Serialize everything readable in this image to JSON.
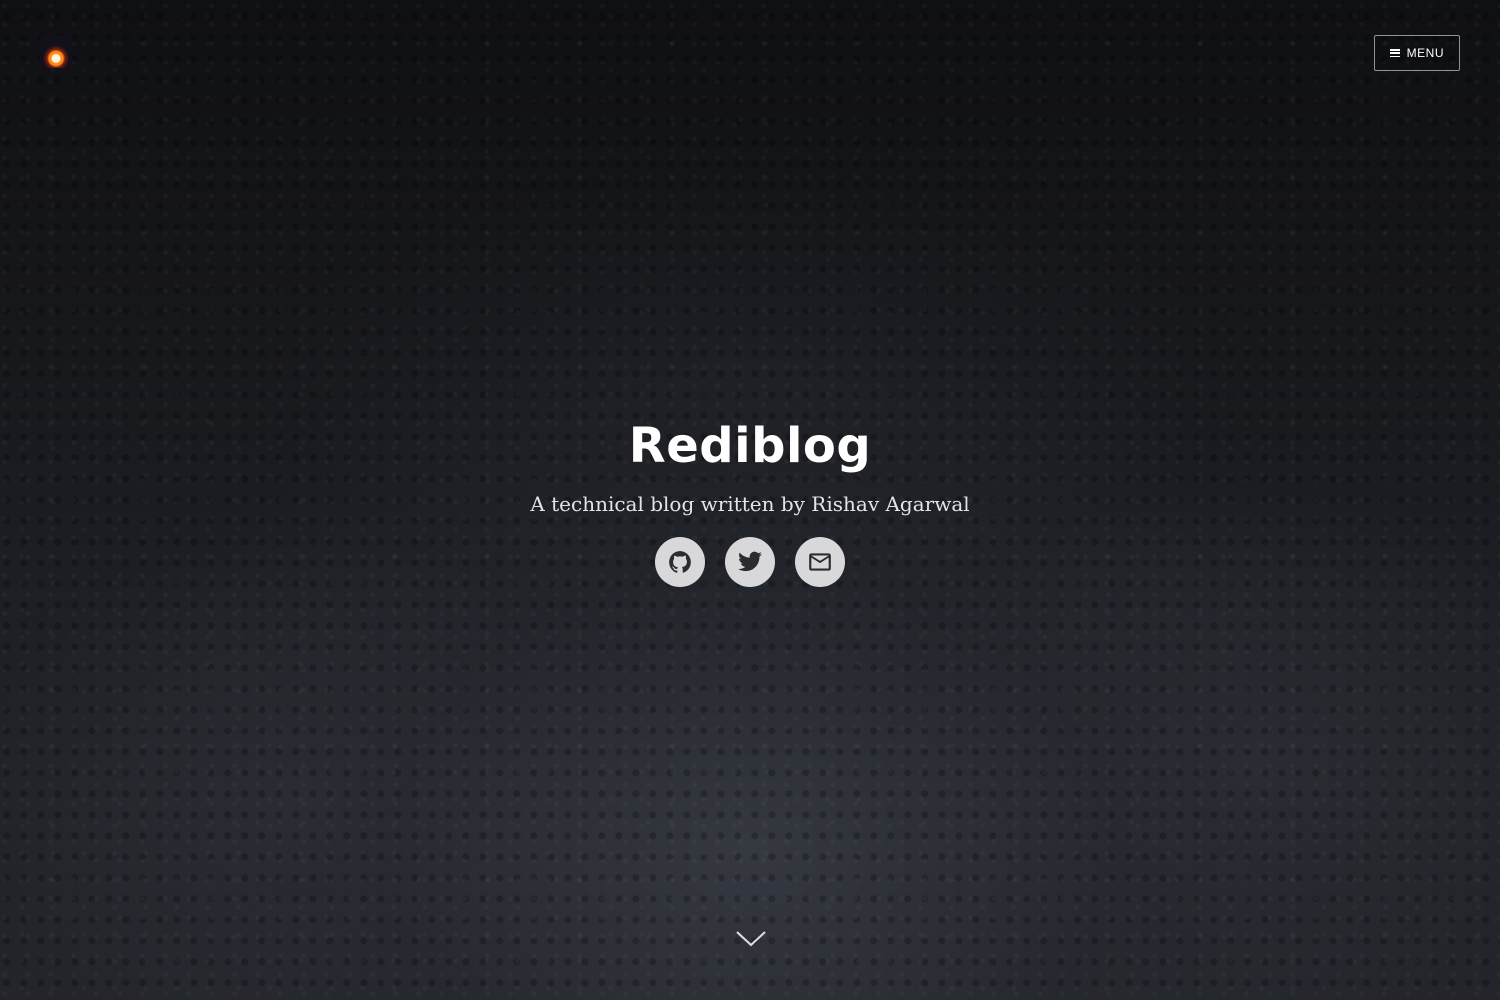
{
  "header": {
    "logo_icon": "campfire-avatar",
    "menu_label": "MENU",
    "menu_icon": "hamburger-icon"
  },
  "hero": {
    "title": "Rediblog",
    "subtitle": "A technical blog written by Rishav Agarwal",
    "social_links": [
      {
        "icon": "github-icon"
      },
      {
        "icon": "twitter-icon"
      },
      {
        "icon": "email-icon"
      }
    ],
    "scroll_icon": "chevron-down-icon"
  },
  "colors": {
    "background": "#121317",
    "text": "#ffffff",
    "social_bg": "#e8e8ea",
    "social_icon": "#2a2c31"
  }
}
